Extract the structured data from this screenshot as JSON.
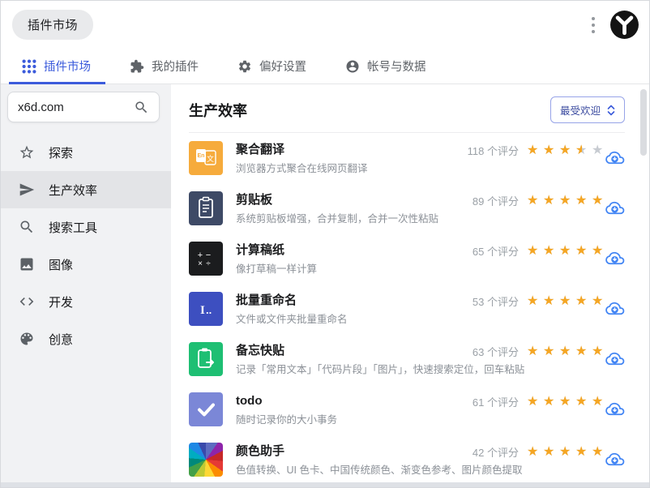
{
  "topbar": {
    "pill_label": "插件市场"
  },
  "tabs": [
    {
      "label": "插件市场",
      "icon": "grid-icon",
      "active": true
    },
    {
      "label": "我的插件",
      "icon": "puzzle-icon",
      "active": false
    },
    {
      "label": "偏好设置",
      "icon": "gear-icon",
      "active": false
    },
    {
      "label": "帐号与数据",
      "icon": "person-icon",
      "active": false
    }
  ],
  "sidebar": {
    "search": {
      "value": "x6d.com",
      "icon": "search-icon"
    },
    "items": [
      {
        "label": "探索",
        "icon": "star-icon",
        "active": false
      },
      {
        "label": "生产效率",
        "icon": "paper-plane-icon",
        "active": true
      },
      {
        "label": "搜索工具",
        "icon": "search-icon",
        "active": false
      },
      {
        "label": "图像",
        "icon": "image-icon",
        "active": false
      },
      {
        "label": "开发",
        "icon": "code-icon",
        "active": false
      },
      {
        "label": "创意",
        "icon": "palette-icon",
        "active": false
      }
    ]
  },
  "main": {
    "title": "生产效率",
    "sort": {
      "label": "最受欢迎",
      "icon": "sort-chevrons-icon"
    },
    "items": [
      {
        "title": "聚合翻译",
        "desc": "浏览器方式聚合在线网页翻译",
        "ratings_text": "118 个评分",
        "rating": 3.5,
        "icon": "translate-tile-icon",
        "icon_bg": "#f6ab3c"
      },
      {
        "title": "剪贴板",
        "desc": "系统剪贴板增强，合并复制，合并一次性粘贴",
        "ratings_text": "89 个评分",
        "rating": 5,
        "icon": "clipboard-tile-icon",
        "icon_bg": "#3e4a66"
      },
      {
        "title": "计算稿纸",
        "desc": "像打草稿一样计算",
        "ratings_text": "65 个评分",
        "rating": 5,
        "icon": "calculator-tile-icon",
        "icon_bg": "#1b1c1e"
      },
      {
        "title": "批量重命名",
        "desc": "文件或文件夹批量重命名",
        "ratings_text": "53 个评分",
        "rating": 5,
        "icon": "rename-tile-icon",
        "icon_bg": "#3d4fc0"
      },
      {
        "title": "备忘快贴",
        "desc": "记录「常用文本」「代码片段」「图片」，快速搜索定位，回车粘贴",
        "ratings_text": "63 个评分",
        "rating": 5,
        "icon": "memo-tile-icon",
        "icon_bg": "#1ebf73"
      },
      {
        "title": "todo",
        "desc": "随时记录你的大小事务",
        "ratings_text": "61 个评分",
        "rating": 5,
        "icon": "todo-tile-icon",
        "icon_bg": "#7b87d7"
      },
      {
        "title": "颜色助手",
        "desc": "色值转换、UI 色卡、中国传统颜色、渐变色参考、图片颜色提取",
        "ratings_text": "42 个评分",
        "rating": 5,
        "icon": "color-wheel-tile-icon",
        "icon_bg": "conic-rainbow"
      }
    ]
  },
  "colors": {
    "accent": "#3b5bdb",
    "star_filled": "#f5a623",
    "star_empty": "#c7cbd1",
    "cloud_blue": "#4285f4"
  }
}
